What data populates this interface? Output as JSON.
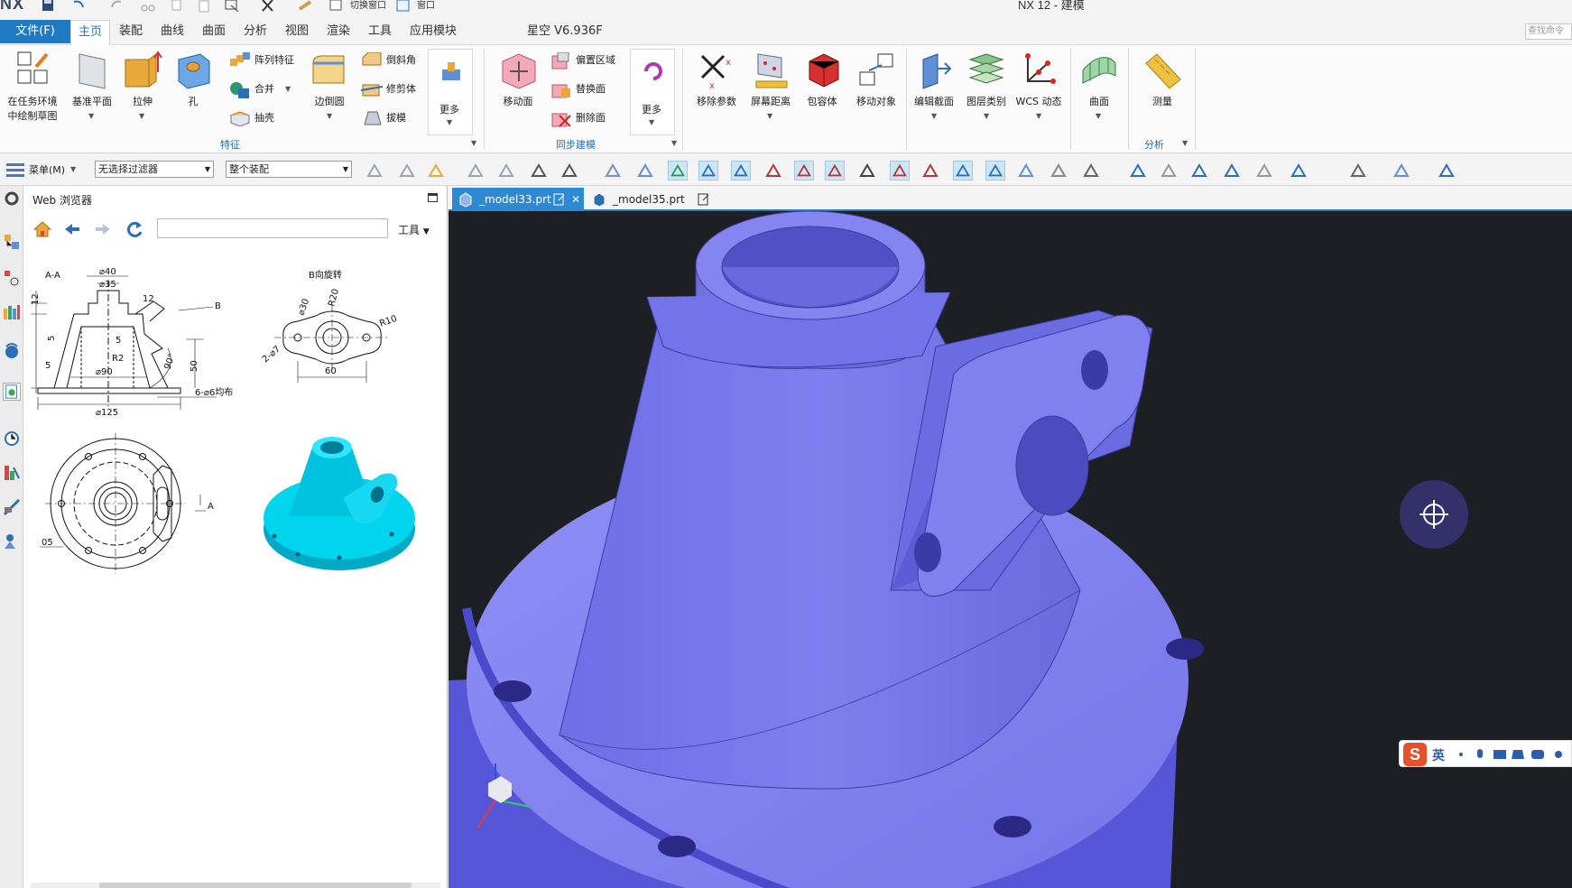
{
  "app": {
    "logo": "NX",
    "window_title": "NX 12 - 建模",
    "quick_access": {
      "switch_window": "切换窗口",
      "window": "窗口"
    }
  },
  "menubar": {
    "file": "文件(F)",
    "tabs": [
      "主页",
      "装配",
      "曲线",
      "曲面",
      "分析",
      "视图",
      "渲染",
      "工具",
      "应用模块",
      "星空 V6.936F"
    ],
    "active_tab": "主页",
    "search_placeholder": "查找命令"
  },
  "ribbon": {
    "sketch_line1": "在任务环境",
    "sketch_line2": "中绘制草图",
    "datum_plane": "基准平面",
    "extrude": "拉伸",
    "hole": "孔",
    "pattern_feature": "阵列特征",
    "unite": "合并",
    "shell": "抽壳",
    "edge_blend": "边倒圆",
    "chamfer": "倒斜角",
    "trim_body": "修剪体",
    "draft": "拔模",
    "more1": "更多",
    "group_feature": "特征",
    "move_face": "移动面",
    "offset_region": "偏置区域",
    "replace_face": "替换面",
    "delete_face": "删除面",
    "more2": "更多",
    "group_sync": "同步建模",
    "remove_params": "移除参数",
    "screen_distance": "屏幕距离",
    "bounding_body": "包容体",
    "move_object": "移动对象",
    "edit_section": "编辑截面",
    "layer_category": "图层类别",
    "wcs_dynamic": "WCS 动态",
    "surface": "曲面",
    "measure": "测量",
    "group_analysis": "分析"
  },
  "toolbar": {
    "menu": "菜单(M)",
    "filter": "无选择过滤器",
    "assembly_scope": "整个装配"
  },
  "web_panel": {
    "title": "Web 浏览器",
    "address_value": "",
    "tools": "工具"
  },
  "drawing": {
    "section_label": "A-A",
    "rotated_label": "B向旋转",
    "dims": {
      "d40": "⌀40",
      "d35": "⌀35",
      "d12a": "12",
      "d12b": "12",
      "d5a": "5",
      "d5b": "5",
      "d5c": "5",
      "r2": "R2",
      "ang90": "90°",
      "d50": "50",
      "d90": "⌀90",
      "d125": "⌀125",
      "holes": "6-⌀6均布",
      "b": "B",
      "d30": "⌀30",
      "r20": "R20",
      "r10": "R10",
      "holes2": "2-⌀7",
      "d60": "60",
      "a": "A",
      "d05": "05"
    }
  },
  "doc_tabs": [
    {
      "label": "_model33.prt",
      "active": true
    },
    {
      "label": "_model35.prt",
      "active": false
    }
  ],
  "ime": {
    "lang": "英"
  },
  "colors": {
    "accent": "#1f7ac4",
    "viewport_bg": "#1e1f25",
    "model": "#7f7ff0",
    "preview_model": "#00d5ee"
  }
}
